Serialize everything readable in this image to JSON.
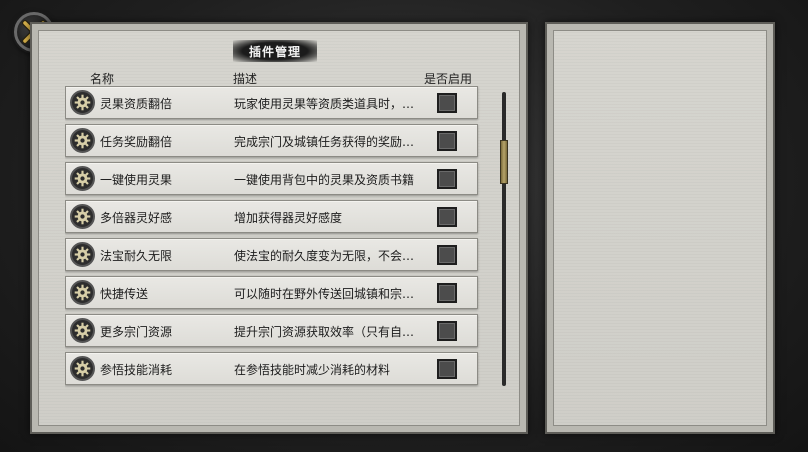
{
  "window": {
    "title": "插件管理",
    "close_icon": "close-x-icon"
  },
  "table": {
    "headers": {
      "name": "名称",
      "description": "描述",
      "enabled": "是否启用"
    },
    "rows": [
      {
        "name": "灵果资质翻倍",
        "description": "玩家使用灵果等资质类道具时，…",
        "enabled": false,
        "icon": "gear-icon"
      },
      {
        "name": "任务奖励翻倍",
        "description": "完成宗门及城镇任务获得的奖励…",
        "enabled": false,
        "icon": "gear-icon"
      },
      {
        "name": "一键使用灵果",
        "description": "一键使用背包中的灵果及资质书籍",
        "enabled": false,
        "icon": "gear-icon"
      },
      {
        "name": "多倍器灵好感",
        "description": "增加获得器灵好感度",
        "enabled": false,
        "icon": "gear-icon"
      },
      {
        "name": "法宝耐久无限",
        "description": "使法宝的耐久度变为无限，不会…",
        "enabled": false,
        "icon": "gear-icon"
      },
      {
        "name": "快捷传送",
        "description": "可以随时在野外传送回城镇和宗…",
        "enabled": false,
        "icon": "gear-icon"
      },
      {
        "name": "更多宗门资源",
        "description": "提升宗门资源获取效率（只有自…",
        "enabled": false,
        "icon": "gear-icon"
      },
      {
        "name": "参悟技能消耗",
        "description": "在参悟技能时减少消耗的材料",
        "enabled": false,
        "icon": "gear-icon"
      }
    ]
  },
  "scroll": {
    "position": 0.17
  }
}
